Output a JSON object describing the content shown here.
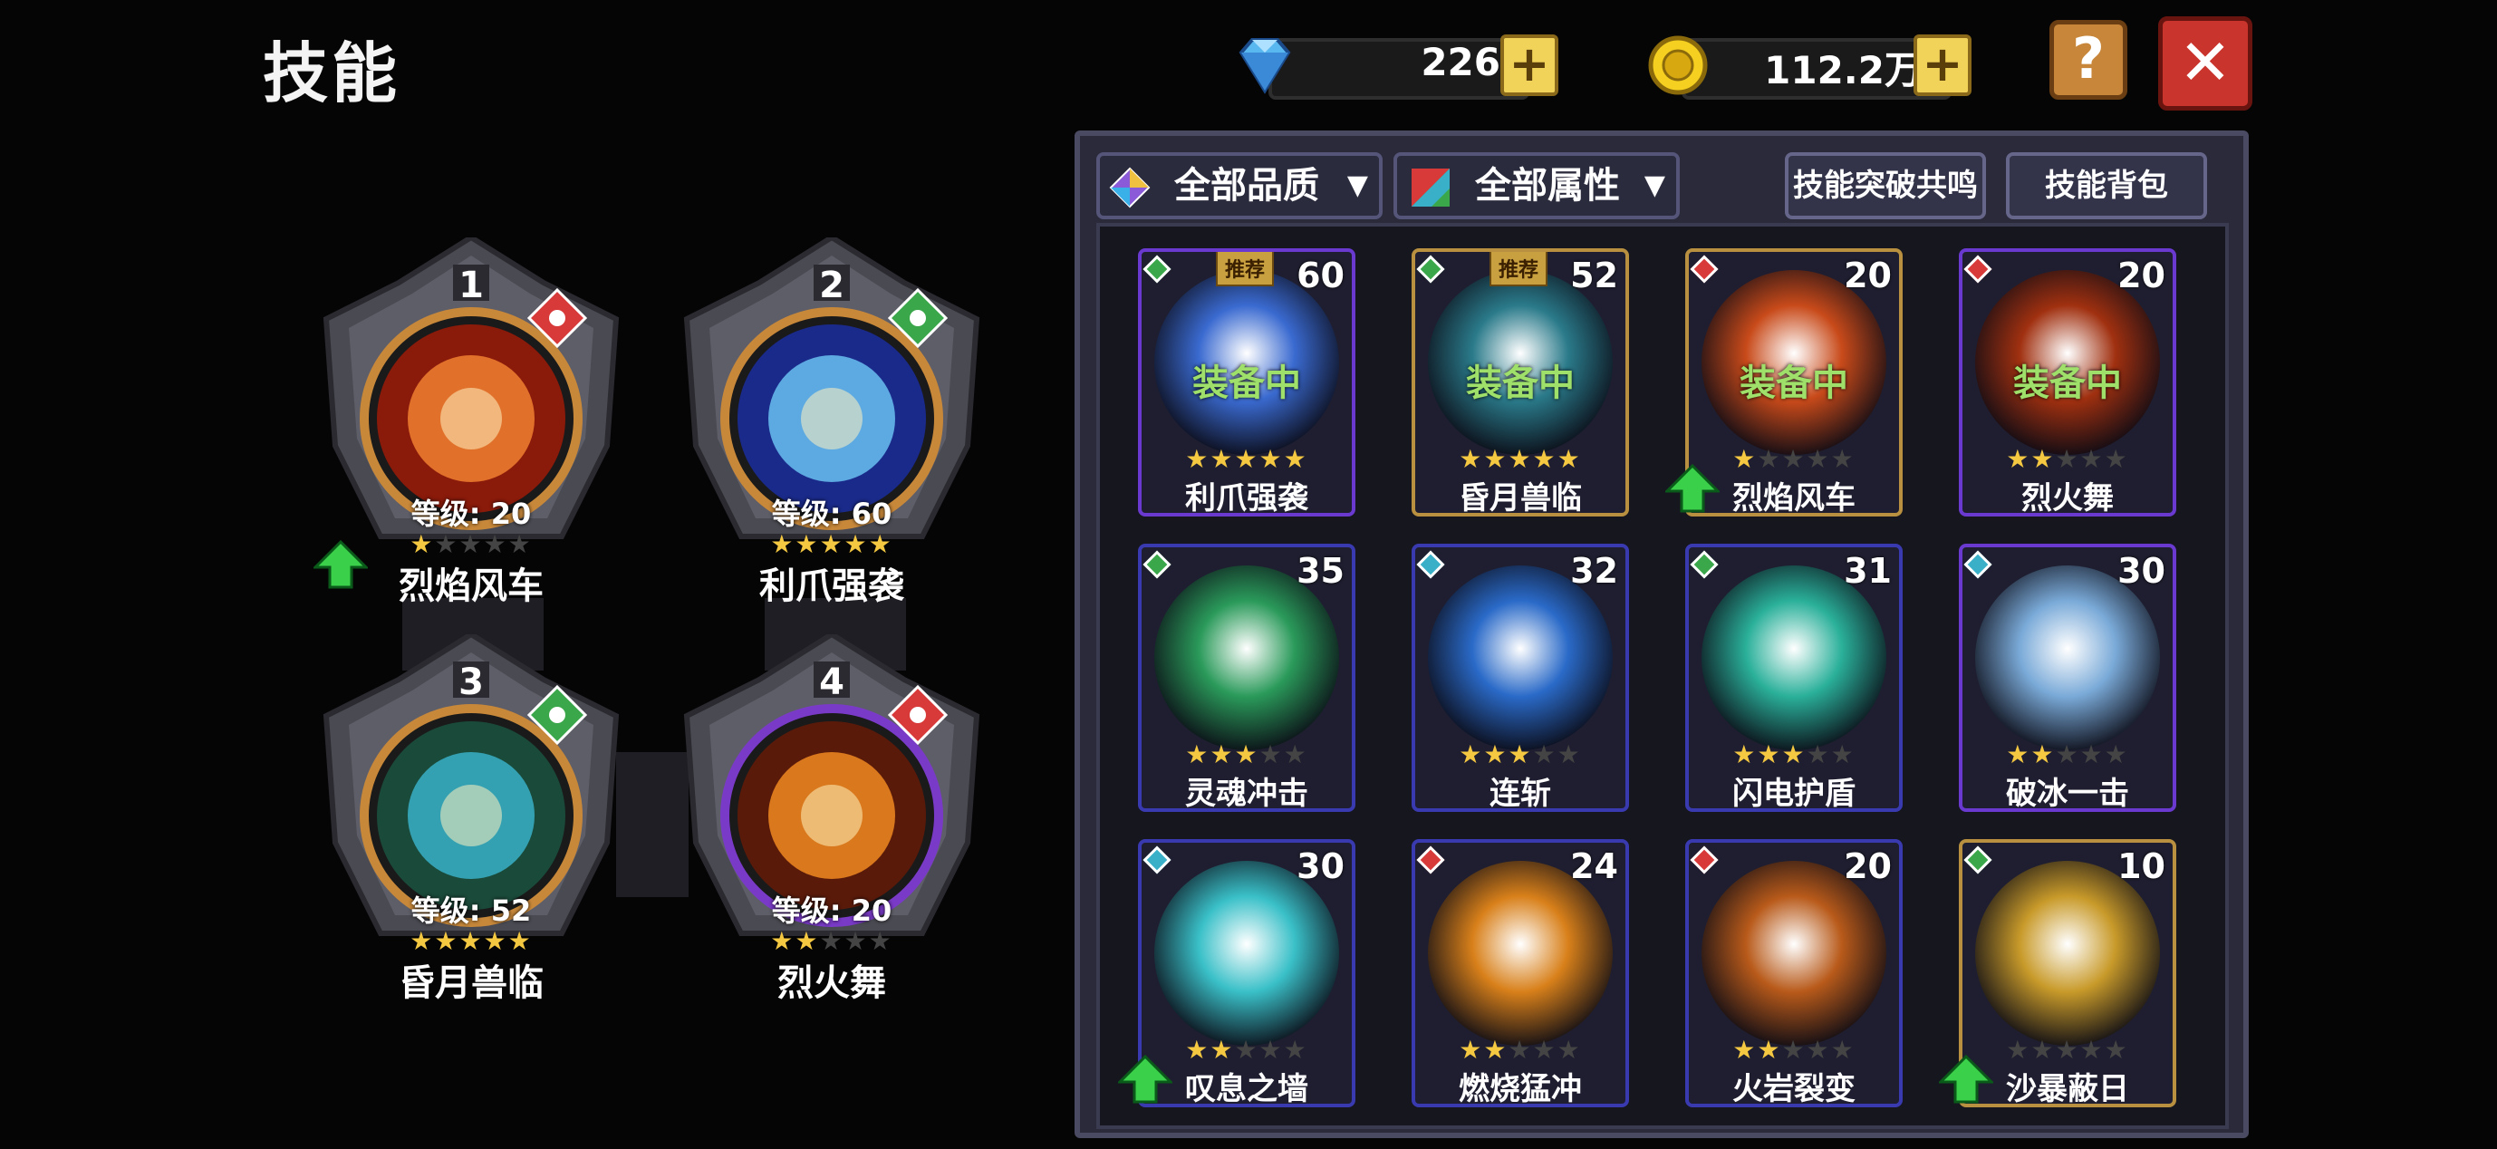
{
  "header": {
    "title": "技能",
    "gems": "226",
    "gold": "112.2万",
    "plus_label": "+",
    "help_label": "?",
    "close_label": "✕"
  },
  "filters": {
    "quality": "全部品质",
    "attribute": "全部属性",
    "resonance": "技能突破共鸣",
    "bag": "技能背包"
  },
  "slots": [
    {
      "num": "1",
      "level": "等级: 20",
      "name": "烈焰风车",
      "stars": 1,
      "element": "fire",
      "upgrade": true
    },
    {
      "num": "2",
      "level": "等级: 60",
      "name": "利爪强袭",
      "stars": 5,
      "element": "wind",
      "upgrade": false
    },
    {
      "num": "3",
      "level": "等级: 52",
      "name": "昏月兽临",
      "stars": 5,
      "element": "wind",
      "upgrade": false
    },
    {
      "num": "4",
      "level": "等级: 20",
      "name": "烈火舞",
      "stars": 2,
      "element": "fire",
      "upgrade": false
    }
  ],
  "cards": [
    {
      "name": "利爪强袭",
      "level": "60",
      "stars": 5,
      "equipped": "装备中",
      "recommend": "推荐",
      "element": "wind",
      "border": "purple",
      "upgrade": false,
      "color": "#3a6ad0"
    },
    {
      "name": "昏月兽临",
      "level": "52",
      "stars": 5,
      "equipped": "装备中",
      "recommend": "推荐",
      "element": "wind",
      "border": "gold",
      "upgrade": false,
      "color": "#2a7a8a"
    },
    {
      "name": "烈焰风车",
      "level": "20",
      "stars": 1,
      "equipped": "装备中",
      "recommend": "",
      "element": "fire",
      "border": "gold",
      "upgrade": true,
      "color": "#c84a1a"
    },
    {
      "name": "烈火舞",
      "level": "20",
      "stars": 2,
      "equipped": "装备中",
      "recommend": "",
      "element": "fire",
      "border": "purple",
      "upgrade": false,
      "color": "#a03010"
    },
    {
      "name": "灵魂冲击",
      "level": "35",
      "stars": 3,
      "equipped": "",
      "recommend": "",
      "element": "wind",
      "border": "blue",
      "upgrade": false,
      "color": "#2a9a5a"
    },
    {
      "name": "连斩",
      "level": "32",
      "stars": 3,
      "equipped": "",
      "recommend": "",
      "element": "ice",
      "border": "blue",
      "upgrade": false,
      "color": "#2a6ac8"
    },
    {
      "name": "闪电护盾",
      "level": "31",
      "stars": 3,
      "equipped": "",
      "recommend": "",
      "element": "wind",
      "border": "blue",
      "upgrade": false,
      "color": "#2ab09a"
    },
    {
      "name": "破冰一击",
      "level": "30",
      "stars": 2,
      "equipped": "",
      "recommend": "",
      "element": "ice",
      "border": "purple",
      "upgrade": false,
      "color": "#7aaad8"
    },
    {
      "name": "叹息之墙",
      "level": "30",
      "stars": 2,
      "equipped": "",
      "recommend": "",
      "element": "ice",
      "border": "blue",
      "upgrade": true,
      "color": "#3ac0c8"
    },
    {
      "name": "燃烧猛冲",
      "level": "24",
      "stars": 2,
      "equipped": "",
      "recommend": "",
      "element": "fire",
      "border": "blue",
      "upgrade": false,
      "color": "#d8801a"
    },
    {
      "name": "火岩裂变",
      "level": "20",
      "stars": 2,
      "equipped": "",
      "recommend": "",
      "element": "fire",
      "border": "blue",
      "upgrade": false,
      "color": "#b85a1a"
    },
    {
      "name": "沙暴蔽日",
      "level": "10",
      "stars": 0,
      "equipped": "",
      "recommend": "",
      "element": "wind",
      "border": "gold",
      "upgrade": true,
      "color": "#c89a2a"
    }
  ],
  "colors": {
    "fire": "#d83a3a",
    "wind": "#3aa84a",
    "ice": "#3ab0c8",
    "star_on": "#f5c842",
    "star_off": "#444444",
    "upgrade": "#3ad04a"
  }
}
